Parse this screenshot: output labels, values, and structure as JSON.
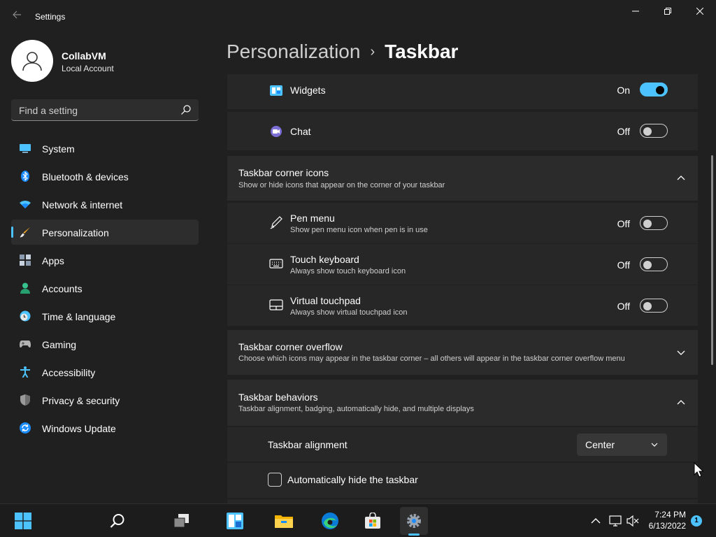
{
  "window": {
    "title": "Settings"
  },
  "profile": {
    "name": "CollabVM",
    "account_type": "Local Account"
  },
  "search": {
    "placeholder": "Find a setting"
  },
  "sidebar": {
    "items": [
      {
        "label": "System",
        "icon": "monitor-icon"
      },
      {
        "label": "Bluetooth & devices",
        "icon": "bluetooth-icon"
      },
      {
        "label": "Network & internet",
        "icon": "wifi-icon"
      },
      {
        "label": "Personalization",
        "icon": "paintbrush-icon",
        "active": true
      },
      {
        "label": "Apps",
        "icon": "apps-icon"
      },
      {
        "label": "Accounts",
        "icon": "person-icon"
      },
      {
        "label": "Time & language",
        "icon": "clock-icon"
      },
      {
        "label": "Gaming",
        "icon": "gamepad-icon"
      },
      {
        "label": "Accessibility",
        "icon": "accessibility-icon"
      },
      {
        "label": "Privacy & security",
        "icon": "shield-icon"
      },
      {
        "label": "Windows Update",
        "icon": "update-icon"
      }
    ]
  },
  "breadcrumb": {
    "parent": "Personalization",
    "separator": "›",
    "current": "Taskbar"
  },
  "taskbar_items": {
    "widgets": {
      "label": "Widgets",
      "state": "On"
    },
    "chat": {
      "label": "Chat",
      "state": "Off"
    }
  },
  "corner_icons": {
    "title": "Taskbar corner icons",
    "description": "Show or hide icons that appear on the corner of your taskbar",
    "items": [
      {
        "title": "Pen menu",
        "description": "Show pen menu icon when pen is in use",
        "state": "Off"
      },
      {
        "title": "Touch keyboard",
        "description": "Always show touch keyboard icon",
        "state": "Off"
      },
      {
        "title": "Virtual touchpad",
        "description": "Always show virtual touchpad icon",
        "state": "Off"
      }
    ]
  },
  "corner_overflow": {
    "title": "Taskbar corner overflow",
    "description": "Choose which icons may appear in the taskbar corner – all others will appear in the taskbar corner overflow menu"
  },
  "behaviors": {
    "title": "Taskbar behaviors",
    "description": "Taskbar alignment, badging, automatically hide, and multiple displays",
    "alignment_label": "Taskbar alignment",
    "alignment_value": "Center",
    "autohide_label": "Automatically hide the taskbar"
  },
  "system_taskbar": {
    "time": "7:24 PM",
    "date": "6/13/2022",
    "notification_count": "1"
  },
  "colors": {
    "accent": "#4cc2ff",
    "background": "#202020",
    "card": "#2b2b2b"
  }
}
